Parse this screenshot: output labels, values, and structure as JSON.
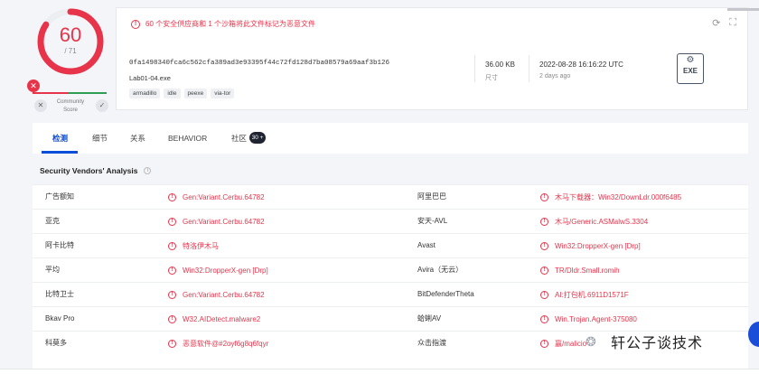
{
  "score": {
    "detections": "60",
    "total": "/ 71",
    "community_label": "Community\nScore"
  },
  "colors": {
    "accent_red": "#e8344b",
    "tab_blue": "#0b4dda",
    "ok_green": "#2f9e55"
  },
  "summary": {
    "alert_text": "60 个安全供应商和 1 个沙箱将此文件标记为恶意文件",
    "hash": "0fa1498340fca6c562cfa389ad3e93395f44c72fd128d7ba08579a69aaf3b126",
    "filename": "Lab01-04.exe",
    "tags": [
      "armadillo",
      "idle",
      "peexe",
      "via-tor"
    ],
    "size_value": "36.00 KB",
    "size_label": "尺寸",
    "date_value": "2022-08-28 16:16:22 UTC",
    "date_label": "2 days ago",
    "file_type": "EXE",
    "icons": [
      "refresh-icon",
      "qr-icon",
      "exe-file-icon"
    ]
  },
  "tabs": [
    {
      "label": "检测",
      "active": true
    },
    {
      "label": "细节"
    },
    {
      "label": "关系"
    },
    {
      "label": "BEHAVIOR"
    },
    {
      "label": "社区",
      "badge": "30 +"
    }
  ],
  "section_title": "Security Vendors' Analysis",
  "vendors": [
    {
      "left_name": "广告额知",
      "left_result": "Gen:Variant.Cerbu.64782",
      "right_name": "阿里巴巴",
      "right_result": "木马下载器：Win32/DownLdr.000f6485"
    },
    {
      "left_name": "亚克",
      "left_result": "Gen:Variant.Cerbu.64782",
      "right_name": "安天-AVL",
      "right_result": "木马/Generic.ASMalwS.3304"
    },
    {
      "left_name": "阿卡比特",
      "left_result": "特洛伊木马",
      "right_name": "Avast",
      "right_result": "Win32:DropperX-gen [Drp]"
    },
    {
      "left_name": "平均",
      "left_result": "Win32:DropperX-gen [Drp]",
      "right_name": "Avira（无云）",
      "right_result": "TR/Dldr.Small.romih"
    },
    {
      "left_name": "比特卫士",
      "left_result": "Gen:Variant.Cerbu.64782",
      "right_name": "BitDefenderTheta",
      "right_result": "AI:打包机.6911D1571F"
    },
    {
      "left_name": "Bkav Pro",
      "left_result": "W32.AIDetect.malware2",
      "right_name": "蛤蜊AV",
      "right_result": "Win.Trojan.Agent-375080"
    },
    {
      "left_name": "科莫多",
      "left_result": "恶意软件@#2oyf6g8q6fqyr",
      "right_name": "众击指渡",
      "right_result": "赢/malicio"
    }
  ],
  "watermark": "轩公子谈技术"
}
